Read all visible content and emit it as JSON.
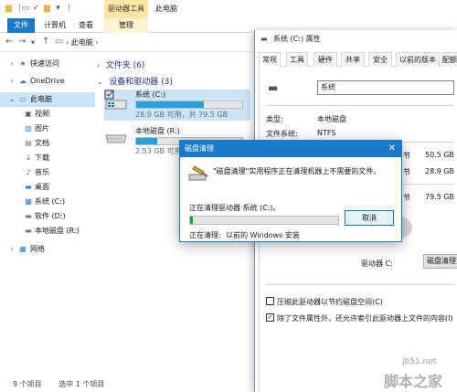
{
  "explorer": {
    "title": "此电脑",
    "context_tab_group": "驱动器工具",
    "tabs": {
      "file": "文件",
      "computer": "计算机",
      "view": "查看",
      "manage": "管理"
    },
    "address": "此电脑",
    "nav": {
      "quick_access": "快速访问",
      "onedrive": "OneDrive",
      "this_pc": "此电脑",
      "items": [
        "视频",
        "图片",
        "文档",
        "下载",
        "音乐",
        "桌面",
        "系统 (C:)",
        "软件 (D:)",
        "本地磁盘 (R:)"
      ],
      "network": "网络"
    },
    "groups": {
      "folders": "文件夹 (6)",
      "devices": "设备和驱动器 (3)"
    },
    "drives": [
      {
        "name": "系统 (C:)",
        "free_text": "28.9 GB 可用，共 79.5 GB",
        "used_fraction": 0.64
      },
      {
        "name": "本地磁盘 (R:)",
        "free_text": "2.53 GB 可用，共 ",
        "used_fraction": 0.2
      }
    ],
    "status": {
      "count": "9 个项目",
      "selected": "选中 1 个项目"
    }
  },
  "properties": {
    "title": "系统 (C:) 属性",
    "tabs": [
      "常规",
      "工具",
      "硬件",
      "共享",
      "安全",
      "以前的版本",
      "配额"
    ],
    "volume_name": "系统",
    "type_label": "类型:",
    "type_value": "本地磁盘",
    "fs_label": "文件系统:",
    "fs_value": "NTFS",
    "used_suffix": "节",
    "used_value": "50.5 GB",
    "free_suffix": "节",
    "free_value": "28.9 GB",
    "cap_suffix": "节",
    "cap_value": "79.5 GB",
    "drive_label": "驱动器 C:",
    "cleanup_button": "磁盘清理",
    "compress_label": "压缩此驱动器以节约磁盘空间(C)",
    "index_label": "除了文件属性外，还允许索引此驱动器上文件的内容(I)",
    "compress_checked": false,
    "index_checked": true
  },
  "cleanup": {
    "title": "磁盘清理",
    "close_glyph": "✕",
    "message": "\"磁盘清理\"实用程序正在清理机器上不需要的文件。",
    "progress_label": "正在清理驱动器 系统 (C:)。",
    "progress_fraction": 0.02,
    "cancel_label": "取消",
    "current_label": "正在清理:",
    "current_value": "以前的 Windows 安装"
  },
  "watermark": {
    "url": "jb51.net",
    "name": "脚本之家"
  },
  "colors": {
    "accent": "#1979ca",
    "drive_bar": "#26a0da",
    "progress": "#06b025",
    "selection": "#cce4f7"
  }
}
